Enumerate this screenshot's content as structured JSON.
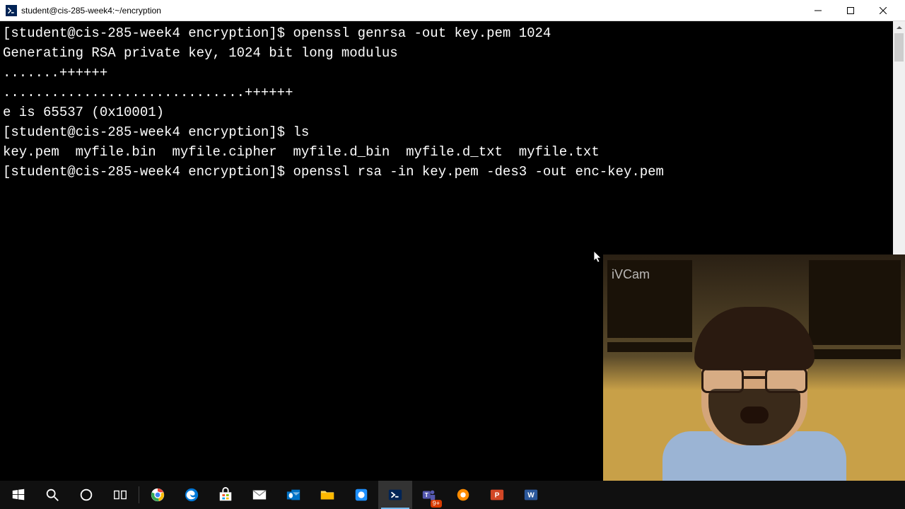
{
  "window": {
    "title": "student@cis-285-week4:~/encryption"
  },
  "terminal": {
    "lines": [
      {
        "prompt": "[student@cis-285-week4 encryption]$ ",
        "cmd": "openssl genrsa -out key.pem 1024"
      },
      {
        "text": "Generating RSA private key, 1024 bit long modulus"
      },
      {
        "text": ".......++++++"
      },
      {
        "text": "..............................++++++"
      },
      {
        "text": "e is 65537 (0x10001)"
      },
      {
        "prompt": "[student@cis-285-week4 encryption]$ ",
        "cmd": "ls"
      },
      {
        "text": "key.pem  myfile.bin  myfile.cipher  myfile.d_bin  myfile.d_txt  myfile.txt"
      },
      {
        "prompt": "[student@cis-285-week4 encryption]$ ",
        "cmd": "openssl rsa -in key.pem -des3 -out enc-key.pem"
      }
    ]
  },
  "webcam": {
    "label": "iVCam"
  },
  "taskbar": {
    "items": [
      {
        "name": "start",
        "icon": "windows"
      },
      {
        "name": "search",
        "icon": "search"
      },
      {
        "name": "cortana",
        "icon": "circle"
      },
      {
        "name": "taskview",
        "icon": "taskview"
      },
      {
        "name": "chrome",
        "icon": "chrome"
      },
      {
        "name": "edge",
        "icon": "edge"
      },
      {
        "name": "store",
        "icon": "store"
      },
      {
        "name": "mail",
        "icon": "mail"
      },
      {
        "name": "outlook",
        "icon": "outlook"
      },
      {
        "name": "explorer",
        "icon": "folder"
      },
      {
        "name": "app-blue",
        "icon": "app-blue"
      },
      {
        "name": "powershell",
        "icon": "powershell",
        "active": true
      },
      {
        "name": "teams",
        "icon": "teams",
        "badge": "9+"
      },
      {
        "name": "snagit",
        "icon": "snagit"
      },
      {
        "name": "powerpoint",
        "icon": "powerpoint"
      },
      {
        "name": "word",
        "icon": "word"
      }
    ]
  }
}
